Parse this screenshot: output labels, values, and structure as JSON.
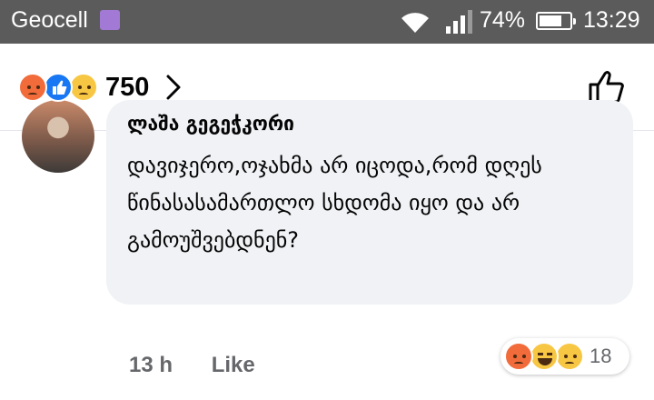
{
  "status_bar": {
    "carrier": "Geocell",
    "battery_percent": "74%",
    "time": "13:29"
  },
  "reactions_header": {
    "count": "750",
    "icons": [
      "angry-emoji",
      "like-emoji",
      "sad-emoji"
    ]
  },
  "comment": {
    "author": "ლაშა გეგეჭკორი",
    "text": "დავიჯერო,ოჯახმა არ იცოდა,რომ დღეს წინასასამართლო სხდომა იყო და არ გამოუშვებდნენ?",
    "time": "13 h",
    "like_label": "Like",
    "reaction_count": "18",
    "reaction_icons": [
      "angry-emoji",
      "haha-emoji",
      "sad-emoji"
    ]
  },
  "colors": {
    "status_bar_bg": "#5b5b5b",
    "bubble_bg": "#f0f2f5",
    "meta_text": "#65676b",
    "like_blue": "#1877f2"
  }
}
